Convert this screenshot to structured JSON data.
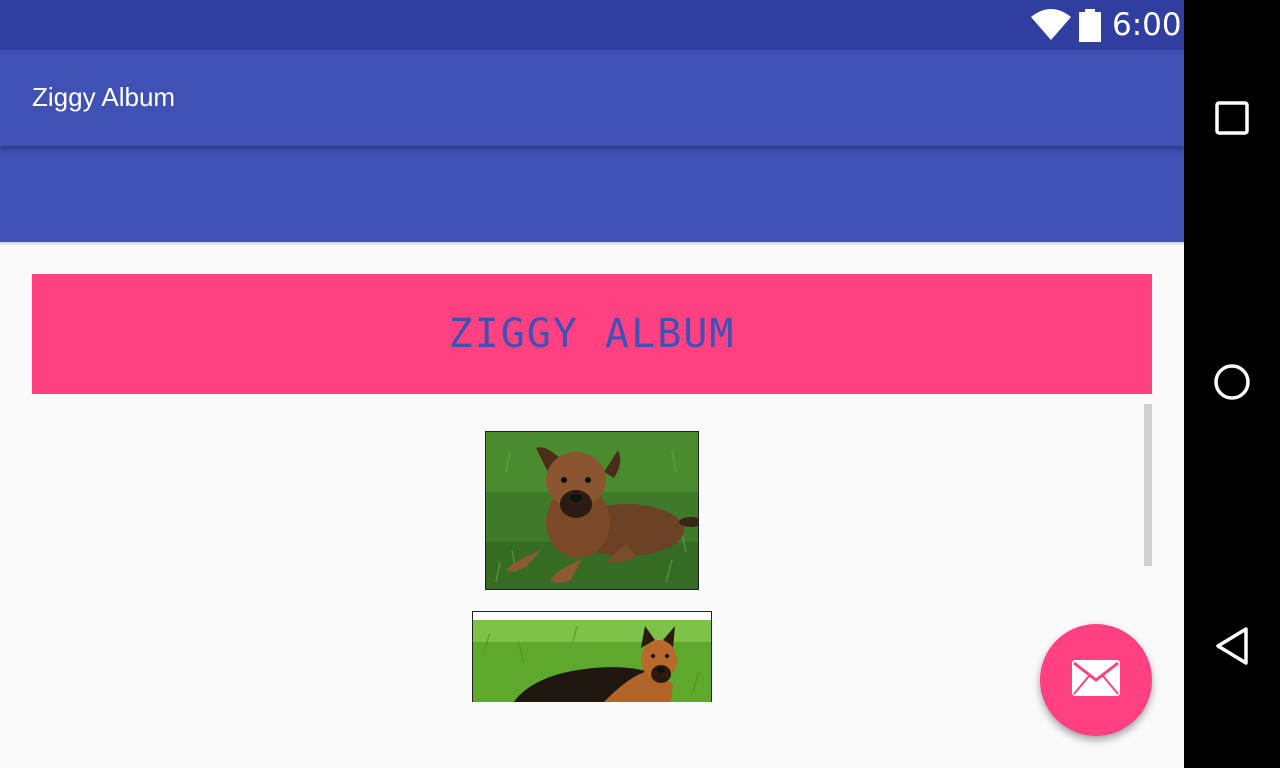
{
  "status_bar": {
    "time": "6:00",
    "icons": [
      "wifi-icon",
      "battery-icon"
    ]
  },
  "toolbar": {
    "title": "Ziggy Album"
  },
  "header": {
    "title": "ZIGGY ALBUM"
  },
  "album": {
    "photos": [
      {
        "name": "puppy-photo"
      },
      {
        "name": "german-shepherd-photo"
      }
    ]
  },
  "fab": {
    "icon": "email-icon"
  },
  "navigation": {
    "buttons": [
      "recents-icon",
      "home-icon",
      "back-icon"
    ]
  },
  "colors": {
    "primary": "#3f51b5",
    "primary_dark": "#303f9f",
    "accent": "#ff4081",
    "background": "#fafafa"
  }
}
